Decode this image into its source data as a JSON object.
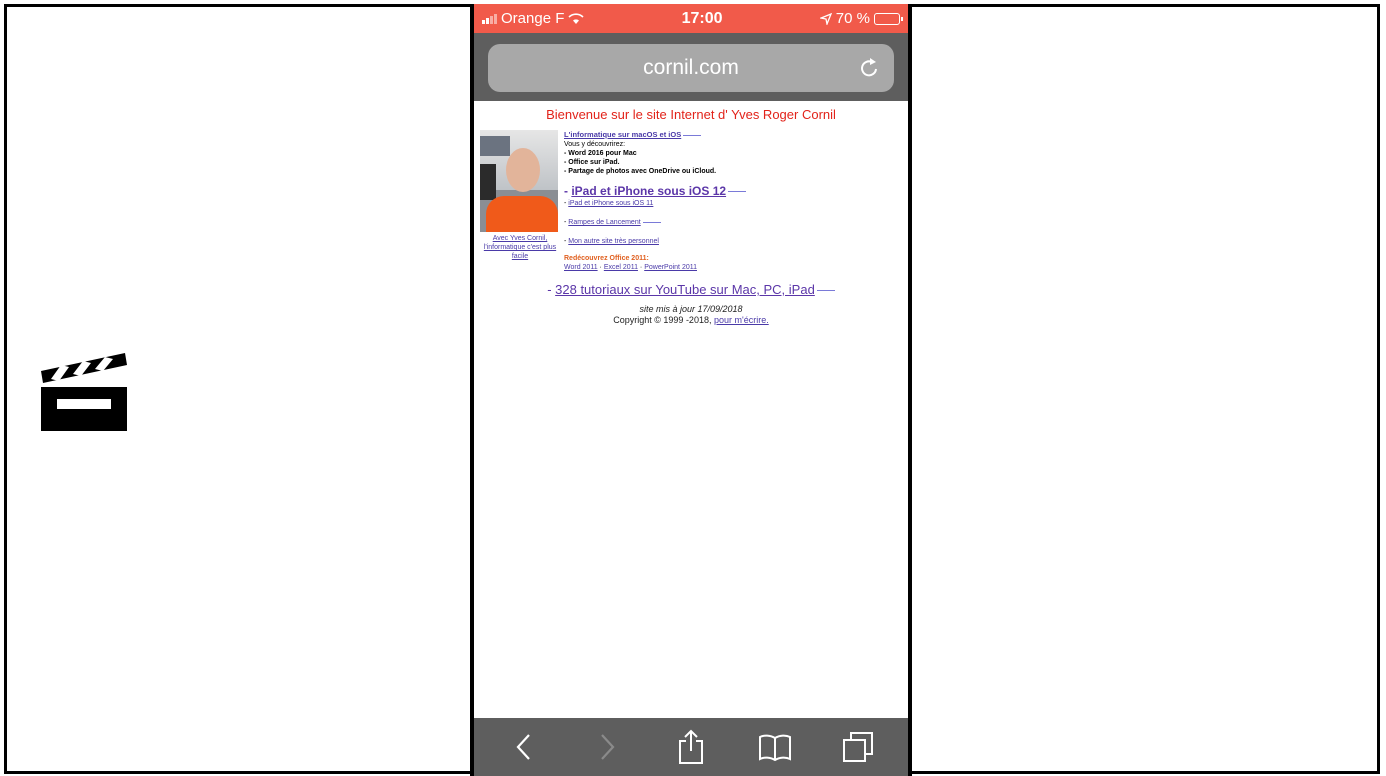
{
  "status_bar": {
    "carrier": "Orange F",
    "time": "17:00",
    "battery": "70 %",
    "battery_level": 0.7
  },
  "browser": {
    "url": "cornil.com"
  },
  "page": {
    "title": "Bienvenue sur le site Internet d' Yves Roger Cornil",
    "photo_caption": "Avec Yves Cornil, l'informatique c'est plus facile",
    "heading_macos": "L'informatique sur macOS et iOS",
    "discover_intro": "Vous y découvrirez:",
    "discover_items": [
      "- Word 2016 pour Mac",
      "- Office sur iPad.",
      "- Partage de photos avec OneDrive ou iCloud."
    ],
    "heading_ipad": "iPad et iPhone sous iOS 12",
    "link_ios11": "iPad et iPhone sous iOS 11",
    "link_rampes": "Rampes de Lancement",
    "link_other_site": "Mon autre site très personnel",
    "office_heading": "Redécouvrez Office 2011:",
    "office_links": [
      "Word 2011",
      "Excel 2011",
      "PowerPoint 2011"
    ],
    "youtube": "328 tutoriaux sur YouTube sur Mac, PC, iPad",
    "updated": "site mis à jour 17/09/2018",
    "copyright": "Copyright © 1999 -2018,",
    "contact_link": "pour m'écrire."
  },
  "toolbar": {
    "icons": [
      "back-icon",
      "forward-icon",
      "share-icon",
      "bookmarks-icon",
      "tabs-icon"
    ]
  },
  "colors": {
    "status_bar": "#f15a4a",
    "title_red": "#e2231a",
    "link_purple": "#5b36a8"
  }
}
